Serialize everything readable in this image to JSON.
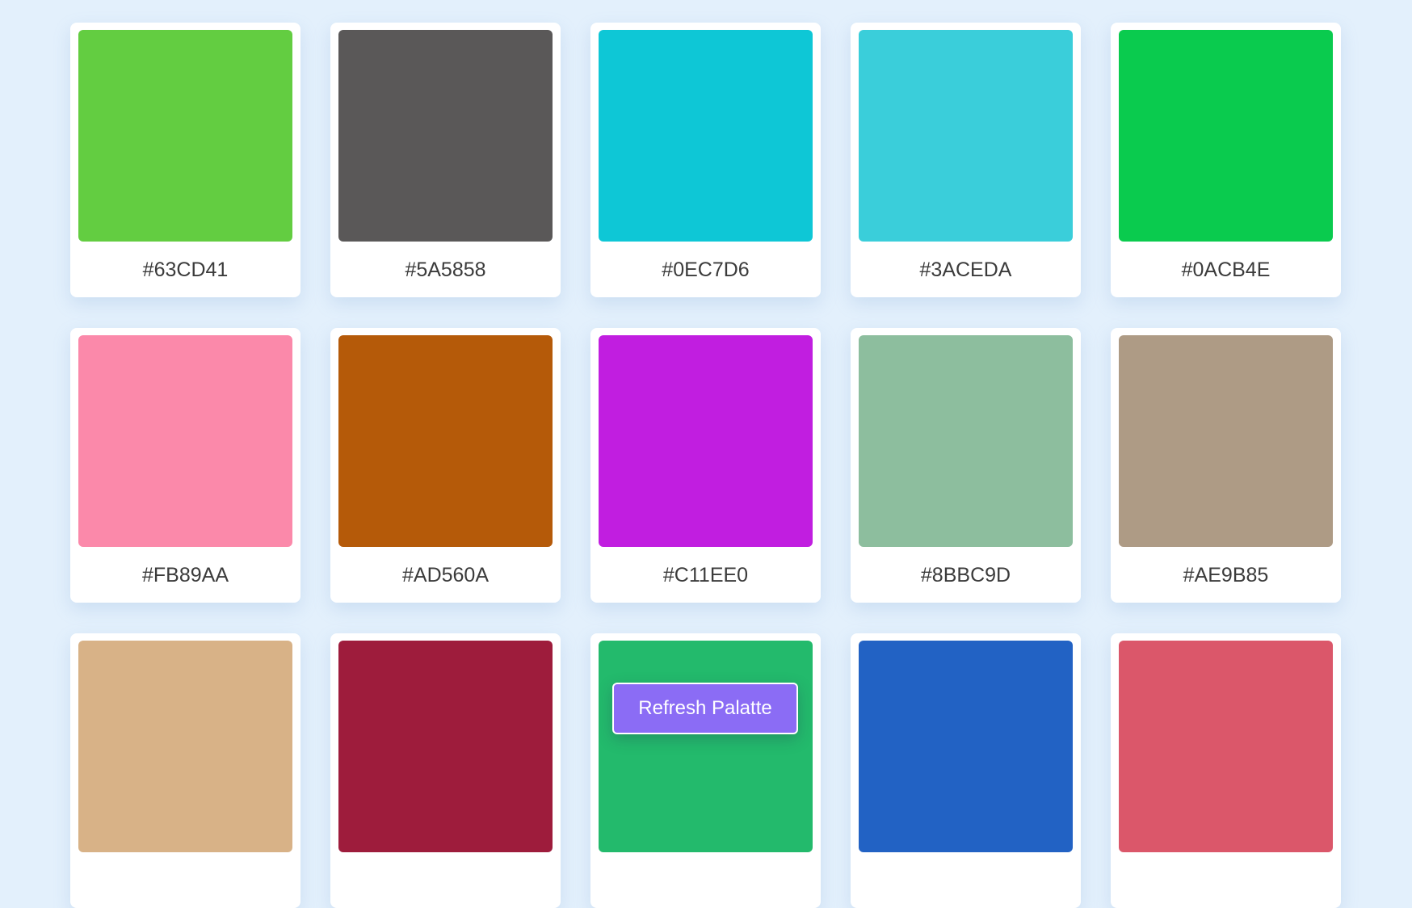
{
  "palette": {
    "colors": [
      {
        "hex": "#63CD41",
        "color": "#63CD41"
      },
      {
        "hex": "#5A5858",
        "color": "#5A5858"
      },
      {
        "hex": "#0EC7D6",
        "color": "#0EC7D6"
      },
      {
        "hex": "#3ACEDA",
        "color": "#3ACEDA"
      },
      {
        "hex": "#0ACB4E",
        "color": "#0ACB4E"
      },
      {
        "hex": "#FB89AA",
        "color": "#FB89AA"
      },
      {
        "hex": "#AD560A",
        "color": "#B55A09"
      },
      {
        "hex": "#C11EE0",
        "color": "#C11EE0"
      },
      {
        "hex": "#8BBC9D",
        "color": "#8DBE9E"
      },
      {
        "hex": "#AE9B85",
        "color": "#AE9B85"
      },
      {
        "hex": "",
        "color": "#D8B287"
      },
      {
        "hex": "",
        "color": "#9E1C3C"
      },
      {
        "hex": "",
        "color": "#23BA6C"
      },
      {
        "hex": "",
        "color": "#2262C4"
      },
      {
        "hex": "",
        "color": "#DB576A"
      }
    ]
  },
  "actions": {
    "refresh_label": "Refresh Palatte",
    "refresh_color": "#8B6CF5"
  },
  "theme": {
    "background": "#E3F0FC"
  }
}
